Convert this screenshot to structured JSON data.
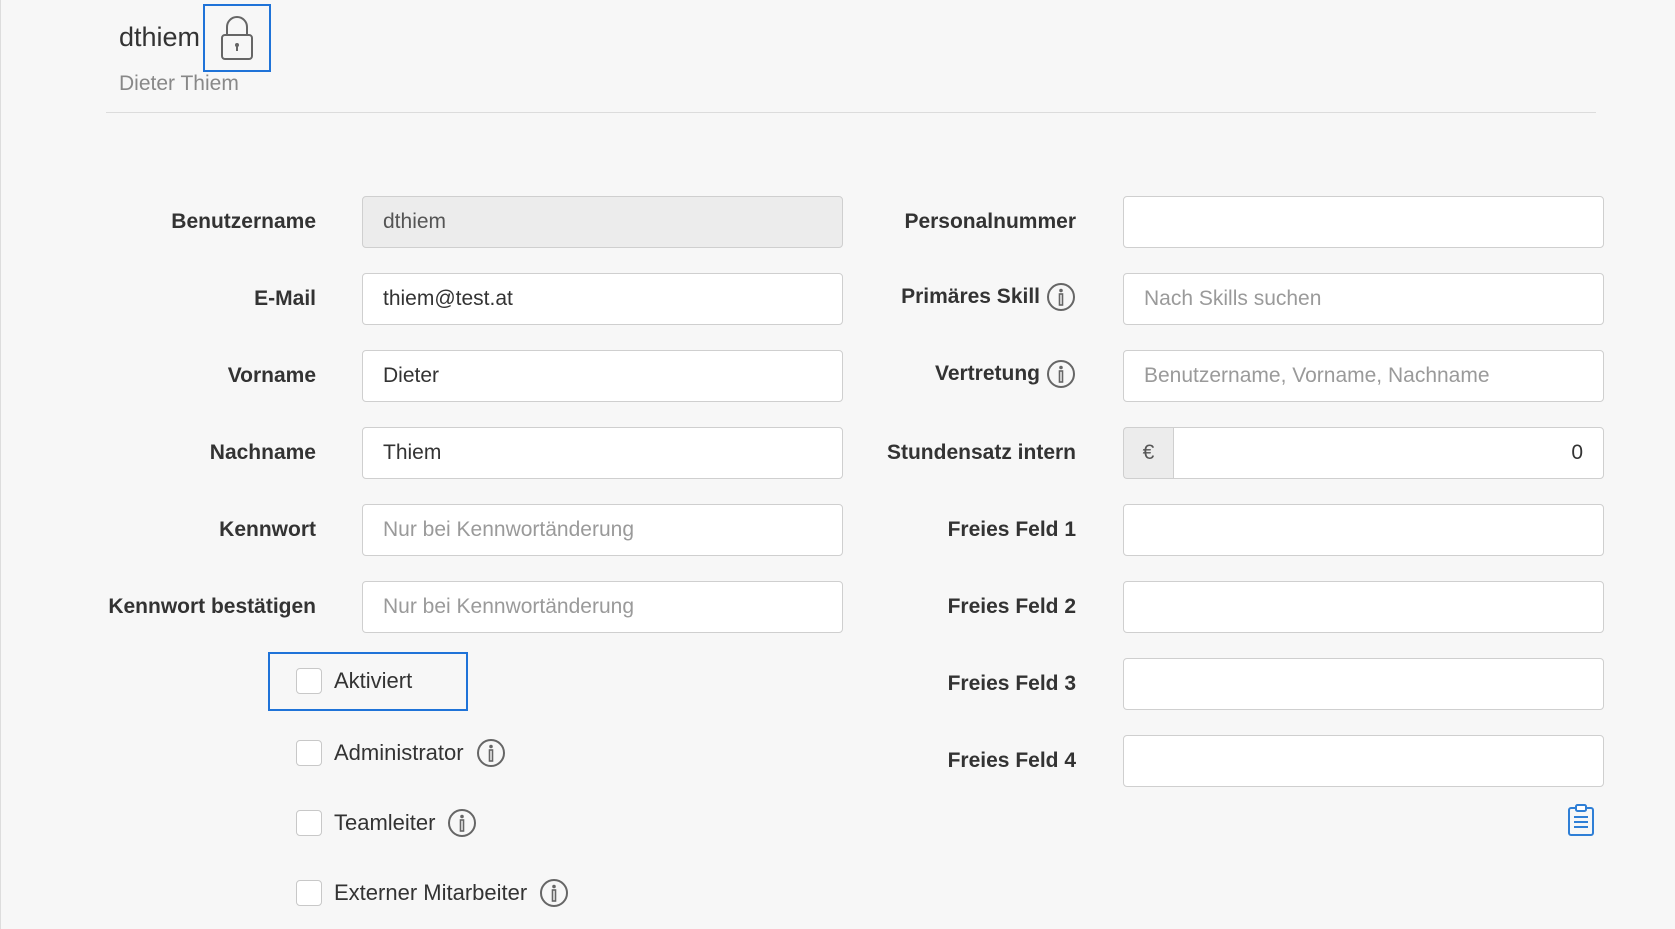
{
  "header": {
    "username": "dthiem",
    "full_name": "Dieter Thiem"
  },
  "form_left": {
    "username": {
      "label": "Benutzername",
      "value": "dthiem"
    },
    "email": {
      "label": "E-Mail",
      "value": "thiem@test.at"
    },
    "first_name": {
      "label": "Vorname",
      "value": "Dieter"
    },
    "last_name": {
      "label": "Nachname",
      "value": "Thiem"
    },
    "password": {
      "label": "Kennwort",
      "placeholder": "Nur bei Kennwortänderung"
    },
    "password_confirm": {
      "label": "Kennwort bestätigen",
      "placeholder": "Nur bei Kennwortänderung"
    }
  },
  "form_right": {
    "personnel_number": {
      "label": "Personalnummer",
      "value": ""
    },
    "primary_skill": {
      "label": "Primäres Skill",
      "placeholder": "Nach Skills suchen"
    },
    "substitute": {
      "label": "Vertretung",
      "placeholder": "Benutzername, Vorname, Nachname"
    },
    "hourly_rate": {
      "label": "Stundensatz intern",
      "currency": "€",
      "value": "0"
    },
    "free_field_1": {
      "label": "Freies Feld 1",
      "value": ""
    },
    "free_field_2": {
      "label": "Freies Feld 2",
      "value": ""
    },
    "free_field_3": {
      "label": "Freies Feld 3",
      "value": ""
    },
    "free_field_4": {
      "label": "Freies Feld 4",
      "value": ""
    }
  },
  "checkboxes": {
    "active": {
      "label": "Aktiviert",
      "checked": false
    },
    "admin": {
      "label": "Administrator",
      "checked": false
    },
    "team_lead": {
      "label": "Teamleiter",
      "checked": false
    },
    "external": {
      "label": "Externer Mitarbeiter",
      "checked": false
    }
  },
  "colors": {
    "focus_outline": "#1f73d8",
    "clipboard_icon": "#2f7fd6"
  }
}
